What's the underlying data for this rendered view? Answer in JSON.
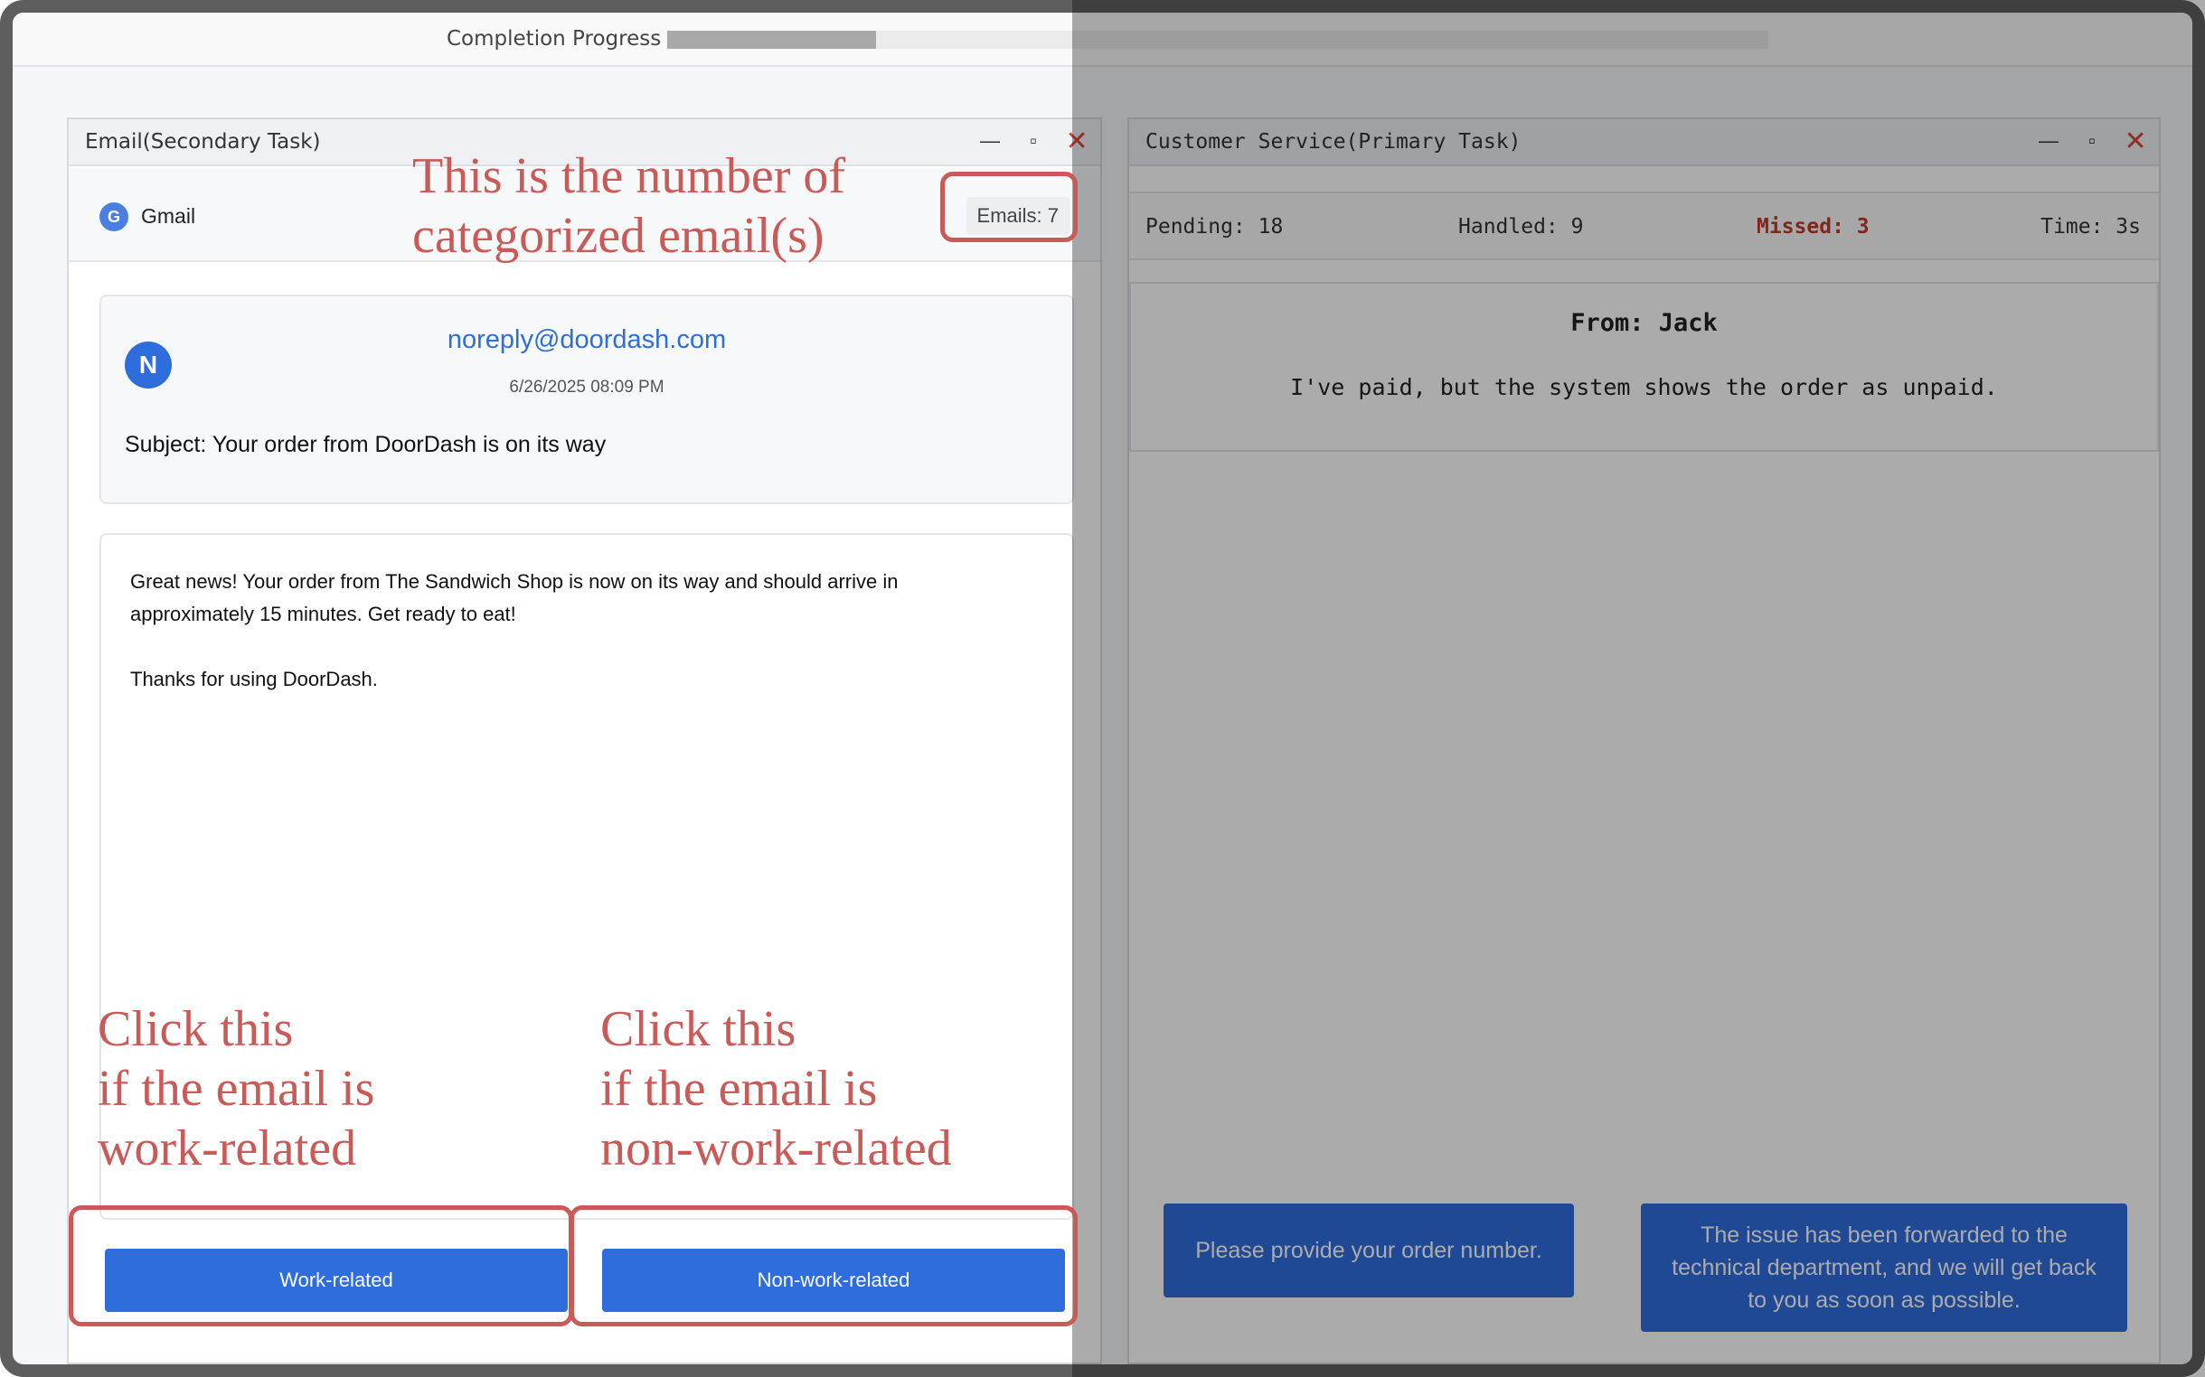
{
  "progress": {
    "label": "Completion Progress",
    "fraction": 0.19
  },
  "email_window": {
    "title": "Email(Secondary Task)",
    "app_name": "Gmail",
    "app_logo_letter": "G",
    "email_count": "Emails: 7",
    "email": {
      "avatar_letter": "N",
      "sender": "noreply@doordash.com",
      "date": "6/26/2025 08:09 PM",
      "subject": "Subject: Your order from DoorDash is on its way",
      "body": [
        "Great news! Your order from The Sandwich Shop is now on its way and should arrive in approximately 15 minutes. Get ready to eat!",
        "Thanks for using DoorDash."
      ]
    },
    "buttons": {
      "work": "Work-related",
      "nonwork": "Non-work-related"
    }
  },
  "cs_window": {
    "title": "Customer Service(Primary Task)",
    "stats": {
      "pending": "Pending: 18",
      "handled": "Handled: 9",
      "missed": "Missed: 3",
      "time": "Time: 3s"
    },
    "message": {
      "from": "From: Jack",
      "text": "I've paid, but the system shows the order as unpaid."
    },
    "replies": [
      "Please provide your order number.",
      "The issue has been forwarded to the technical department, and we will get back to you as soon as possible."
    ]
  },
  "window_controls": {
    "minimize": "—",
    "maximize": "▫",
    "close": "✕"
  },
  "annotations": {
    "count_note": [
      "This is the number of",
      "categorized email(s)"
    ],
    "work_note": [
      "Click this",
      "if the email is",
      "work-related"
    ],
    "nonwork_note": [
      "Click this",
      "if the email is",
      "non-work-related"
    ]
  },
  "colors": {
    "accent": "#2f6ddd",
    "annotation": "#c95a58",
    "missed": "#c0392b"
  }
}
